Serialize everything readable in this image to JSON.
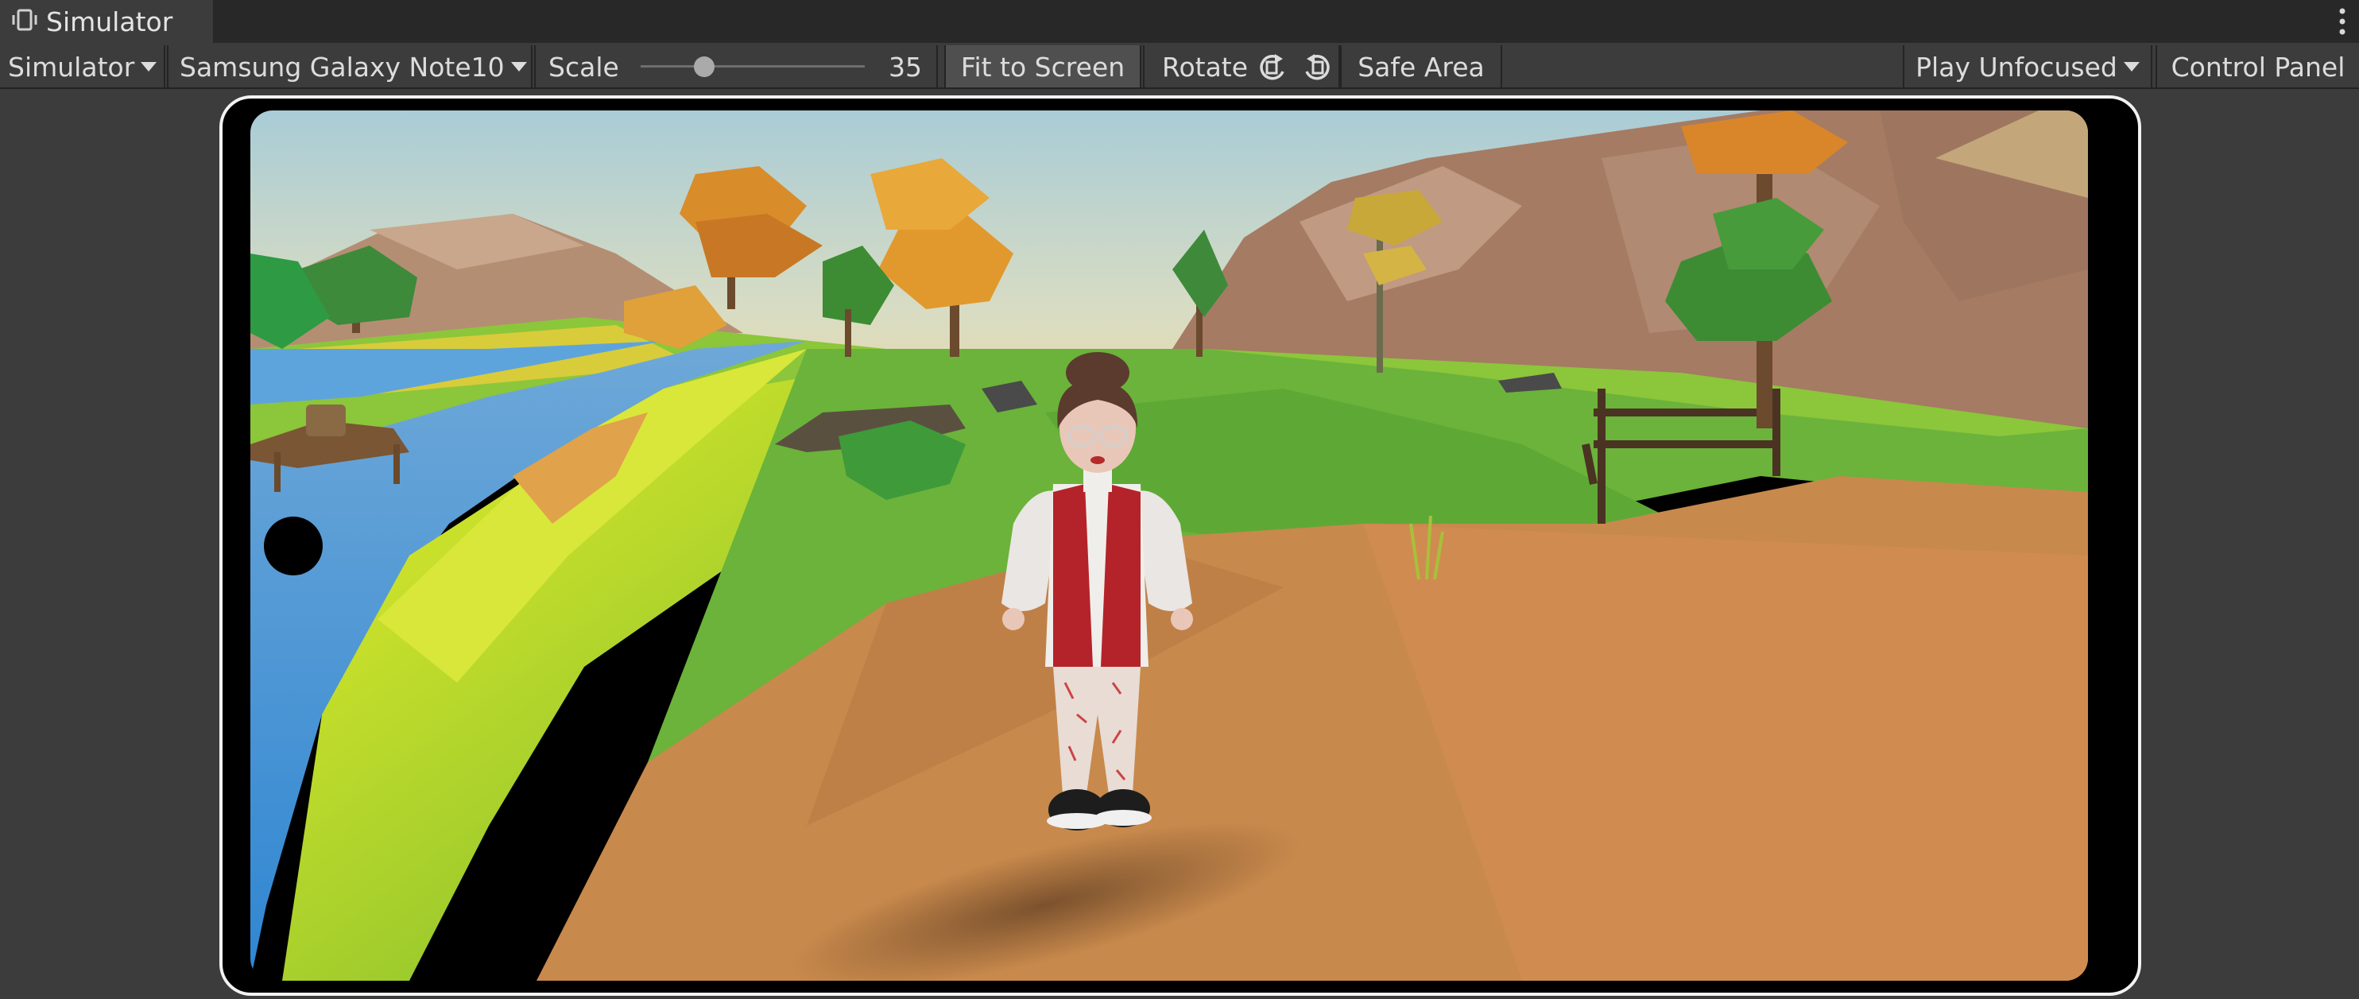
{
  "tab": {
    "title": "Simulator",
    "icon": "simulator-device-icon"
  },
  "toolbar": {
    "simulator_label": "Simulator",
    "device_label": "Samsung Galaxy Note10",
    "scale_label": "Scale",
    "scale_value": "35",
    "fit_label": "Fit to Screen",
    "rotate_label": "Rotate",
    "safe_area_label": "Safe Area",
    "play_mode_label": "Play Unfocused",
    "control_panel_label": "Control Panel"
  },
  "colors": {
    "editor_background": "#3c3c3c",
    "tab_strip": "#282828",
    "device_bezel": "#000000",
    "device_outline": "#f2f2f2"
  }
}
